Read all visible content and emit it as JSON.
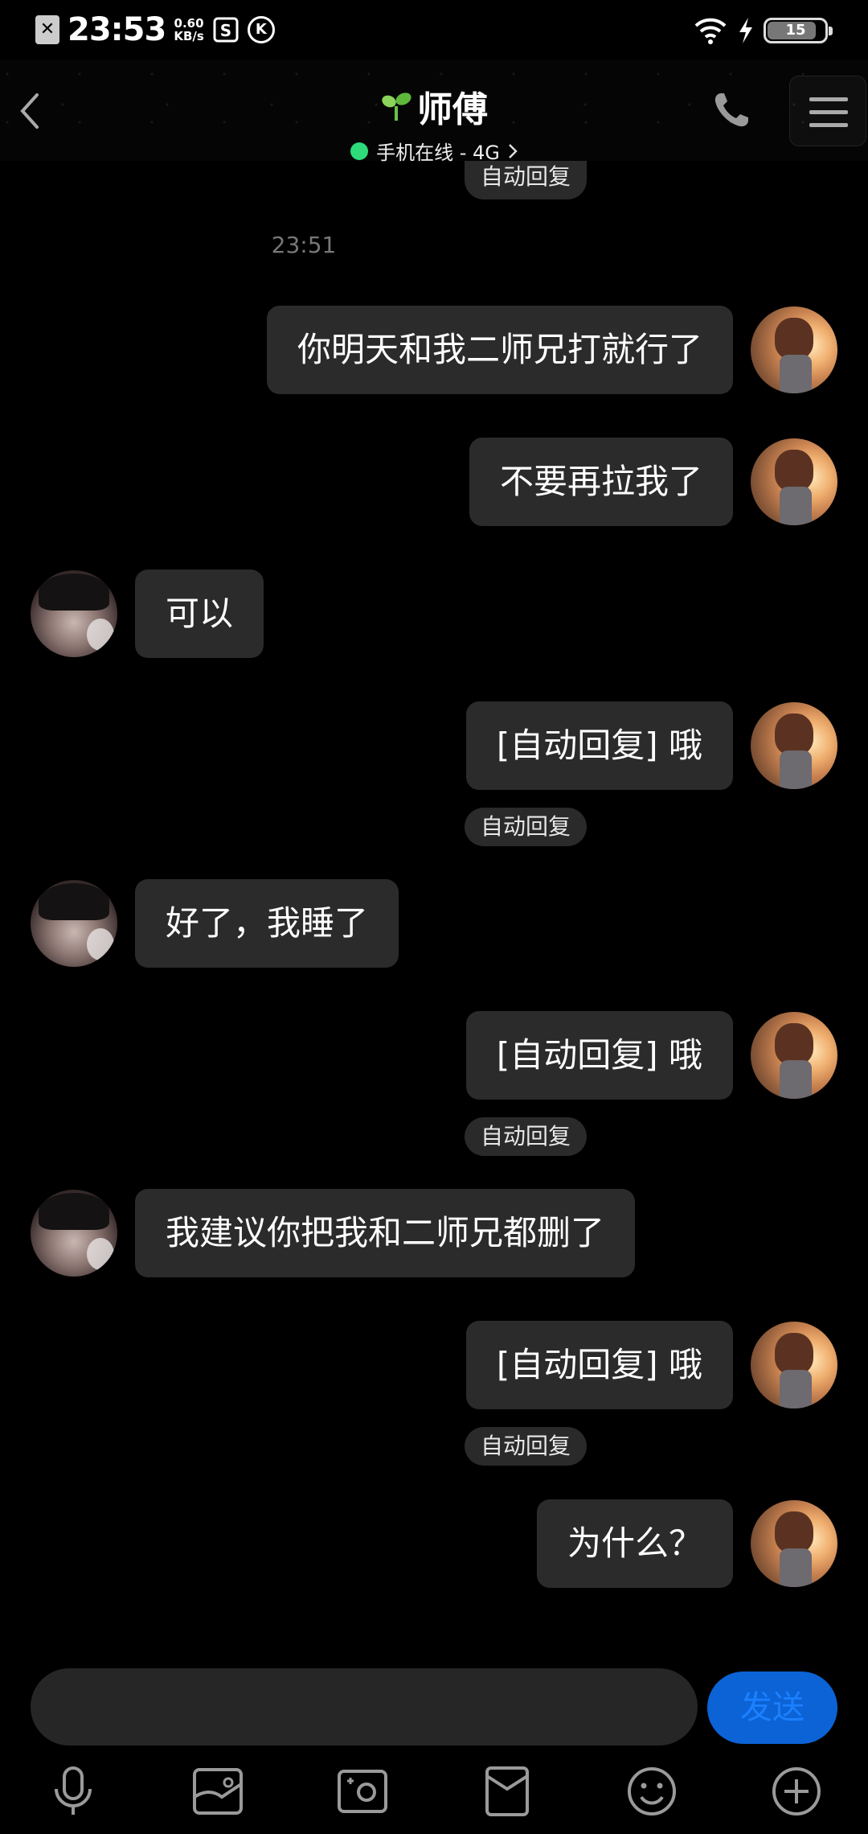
{
  "status_bar": {
    "time": "23:53",
    "speed_value": "0.60",
    "speed_unit": "KB/s",
    "battery": "15"
  },
  "header": {
    "contact_name": "师傅",
    "status": "手机在线 - 4G",
    "online_color": "#2ddb7a"
  },
  "chat": {
    "top_auto_tag": "自动回复",
    "timestamp": "23:51",
    "messages": [
      {
        "side": "right",
        "text": "你明天和我二师兄打就行了"
      },
      {
        "side": "right",
        "text": "不要再拉我了"
      },
      {
        "side": "left",
        "text": "可以"
      },
      {
        "side": "right",
        "text": "[自动回复] 哦",
        "tag": "自动回复"
      },
      {
        "side": "left",
        "text": "好了，我睡了"
      },
      {
        "side": "right",
        "text": "[自动回复] 哦",
        "tag": "自动回复"
      },
      {
        "side": "left",
        "text": "我建议你把我和二师兄都删了"
      },
      {
        "side": "right",
        "text": "[自动回复] 哦",
        "tag": "自动回复"
      },
      {
        "side": "right",
        "text": "为什么？"
      }
    ]
  },
  "input": {
    "value": "",
    "placeholder": "",
    "send_label": "发送",
    "send_color": "#0b63d6"
  },
  "toolbar": {
    "icons": [
      "microphone-icon",
      "image-icon",
      "camera-icon",
      "red-packet-icon",
      "emoji-icon",
      "plus-icon"
    ]
  }
}
